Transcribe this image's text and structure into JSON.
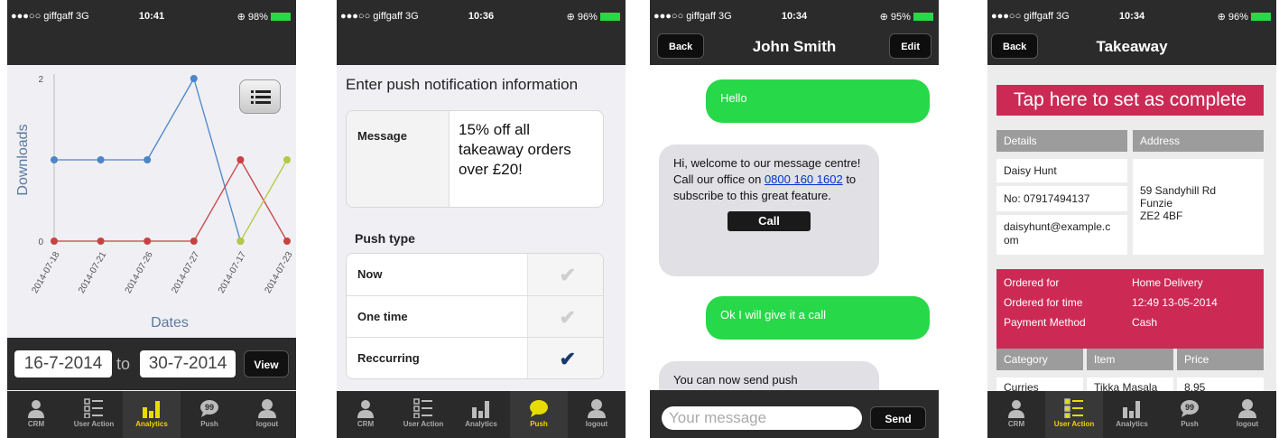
{
  "status": [
    {
      "carrier": "●●●○○ giffgaff  3G",
      "time": "10:41",
      "battery": "⊕ 98%"
    },
    {
      "carrier": "●●●○○ giffgaff  3G",
      "time": "10:36",
      "battery": "⊕ 96%"
    },
    {
      "carrier": "●●●○○ giffgaff  3G",
      "time": "10:34",
      "battery": "⊕ 95%"
    },
    {
      "carrier": "●●●○○ giffgaff  3G",
      "time": "10:34",
      "battery": "⊕ 96%"
    }
  ],
  "tabs": [
    "CRM",
    "User Action",
    "Analytics",
    "Push",
    "logout"
  ],
  "analytics": {
    "date_from": "16-7-2014",
    "to_label": "to",
    "date_to": "30-7-2014",
    "view_label": "View",
    "chart_data": {
      "type": "line",
      "xlabel": "Dates",
      "ylabel": "Downloads",
      "categories": [
        "2014-07-18",
        "2014-07-21",
        "2014-07-26",
        "2014-07-27",
        "2014-07-17",
        "2014-07-23"
      ],
      "y_ticks": [
        "0",
        "2"
      ],
      "ylim": [
        0,
        2
      ],
      "series": [
        {
          "color": "#4a86c8",
          "values": [
            1,
            1,
            1,
            2,
            0,
            null
          ]
        },
        {
          "color": "#c84242",
          "values": [
            0,
            0,
            0,
            0,
            1,
            0
          ]
        },
        {
          "color": "#b5c842",
          "values": [
            null,
            null,
            null,
            null,
            0,
            1
          ]
        }
      ]
    }
  },
  "push": {
    "heading": "Enter push notification information",
    "message_label": "Message",
    "message_lines": [
      "15% off all",
      "takeaway orders",
      "over £20!"
    ],
    "push_type_label": "Push type",
    "options": [
      {
        "label": "Now",
        "checked": false
      },
      {
        "label": "One time",
        "checked": false
      },
      {
        "label": "Reccurring",
        "checked": true
      }
    ]
  },
  "chat": {
    "back": "Back",
    "title": "John Smith",
    "edit": "Edit",
    "msg1": "Hello",
    "msg2a": "Hi, welcome to our message centre! Call our office on ",
    "phone_link": "0800 160 1602",
    "msg2b": " to subscribe to this great feature.",
    "call": "Call",
    "msg3": "Ok I will give it a call",
    "msg4": "You can now send push",
    "input_placeholder": "Your message",
    "send": "Send"
  },
  "takeaway": {
    "back": "Back",
    "title": "Takeaway",
    "tap": "Tap here to set as complete",
    "details_h": "Details",
    "address_h": "Address",
    "name": "Daisy Hunt",
    "phone": "No: 07917494137",
    "email_l1": "daisyhunt@example.c",
    "email_l2": "om",
    "addr1": "59 Sandyhill Rd",
    "addr2": "Funzie",
    "addr3": "ZE2 4BF",
    "ordered_for_l": "Ordered for",
    "ordered_for_v": "Home Delivery",
    "ordered_time_l": "Ordered for time",
    "ordered_time_v": "12:49 13-05-2014",
    "payment_l": "Payment Method",
    "payment_v": "Cash",
    "cat_h": "Category",
    "item_h": "Item",
    "price_h": "Price",
    "cat1": "Curries",
    "item1": "Tikka Masala",
    "price1": "8.95"
  }
}
